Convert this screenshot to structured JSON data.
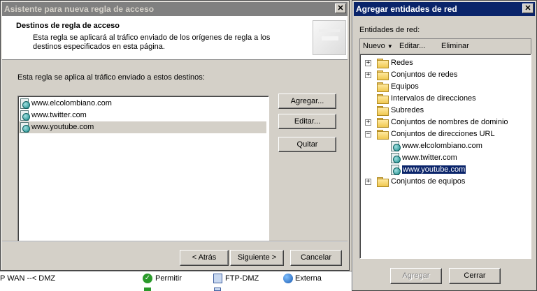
{
  "wizard": {
    "title": "Asistente para nueva regla de acceso",
    "header_title": "Destinos de regla de acceso",
    "header_desc": "Esta regla se aplicará al tráfico enviado de los orígenes de regla a los destinos especificados en esta página.",
    "list_label": "Esta regla se aplica al tráfico enviado a estos destinos:",
    "destinations": [
      "www.elcolombiano.com",
      "www.twitter.com",
      "www.youtube.com"
    ],
    "add_label": "Agregar...",
    "edit_label": "Editar...",
    "remove_label": "Quitar",
    "back_label": "< Atrás",
    "next_label": "Siguiente >",
    "cancel_label": "Cancelar"
  },
  "panel": {
    "title": "Agregar entidades de red",
    "entities_label": "Entidades de red:",
    "toolbar": {
      "new": "Nuevo",
      "edit": "Editar...",
      "delete": "Eliminar"
    },
    "tree": [
      {
        "label": "Redes",
        "expander": "+"
      },
      {
        "label": "Conjuntos de redes",
        "expander": "+"
      },
      {
        "label": "Equipos",
        "expander": ""
      },
      {
        "label": "Intervalos de direcciones",
        "expander": ""
      },
      {
        "label": "Subredes",
        "expander": ""
      },
      {
        "label": "Conjuntos de nombres de dominio",
        "expander": "+"
      },
      {
        "label": "Conjuntos de direcciones URL",
        "expander": "−"
      },
      {
        "label": "www.elcolombiano.com",
        "child": true
      },
      {
        "label": "www.twitter.com",
        "child": true
      },
      {
        "label": "www.youtube.com",
        "child": true,
        "selected": true
      },
      {
        "label": "Conjuntos de equipos",
        "expander": "+"
      }
    ],
    "add_label": "Agregar",
    "close_label": "Cerrar"
  },
  "background_row": {
    "name": "P WAN --< DMZ",
    "action": "Permitir",
    "protocol": "FTP-DMZ",
    "network": "Externa"
  },
  "colors": {
    "title_inactive": "#808080",
    "title_active": "#0a246a",
    "selection": "#0a246a"
  }
}
